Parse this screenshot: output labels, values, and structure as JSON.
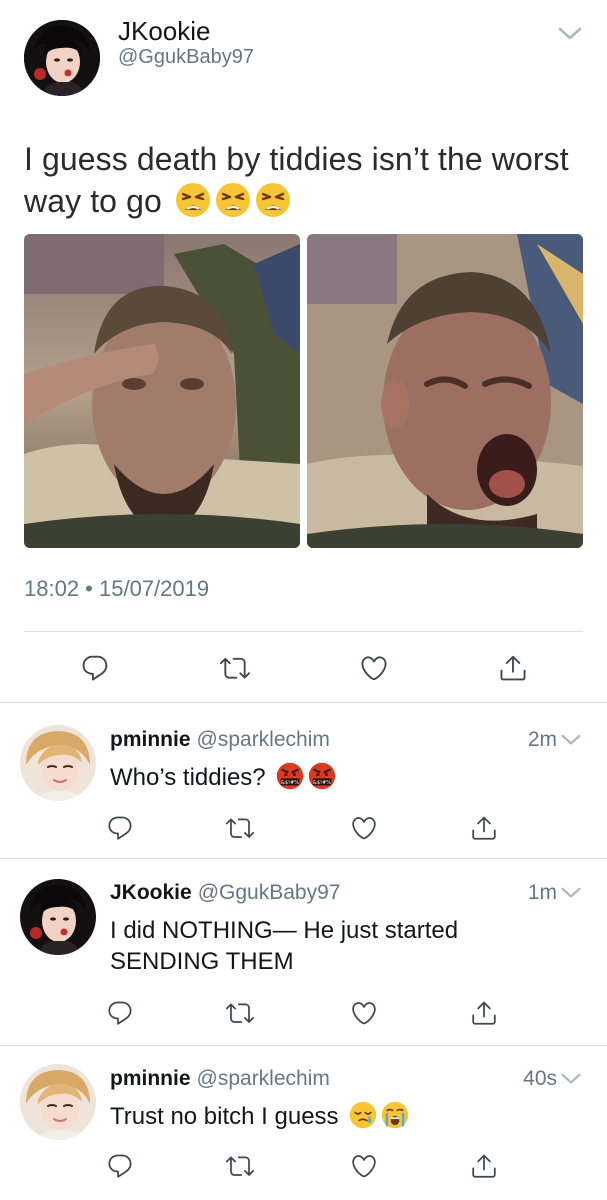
{
  "main_tweet": {
    "author_name": "JKookie",
    "author_handle": "@GgukBaby97",
    "text": "I guess death by tiddies isn’t the worst way to go",
    "text_emojis": [
      "tired-face",
      "tired-face",
      "tired-face"
    ],
    "timestamp": "18:02 • 15/07/2019",
    "media": [
      "saluting-man-photo",
      "screaming-man-photo"
    ]
  },
  "actions": [
    "reply-icon",
    "retweet-icon",
    "like-icon",
    "share-icon"
  ],
  "replies": [
    {
      "name": "pminnie",
      "handle": "@sparklechim",
      "time": "2m",
      "text": "Who’s tiddies?",
      "emojis": [
        "cursing-face",
        "cursing-face"
      ]
    },
    {
      "name": "JKookie",
      "handle": "@GgukBaby97",
      "time": "1m",
      "text": "I did NOTHING— He just started SENDING THEM",
      "emojis": []
    },
    {
      "name": "pminnie",
      "handle": "@sparklechim",
      "time": "40s",
      "text": "Trust no bitch I guess",
      "emojis": [
        "sleepy-face",
        "loudly-crying-face"
      ]
    }
  ],
  "colors": {
    "text": "#14171a",
    "secondary": "#657786",
    "divider": "#d8dee2",
    "icon": "#3d4852"
  }
}
